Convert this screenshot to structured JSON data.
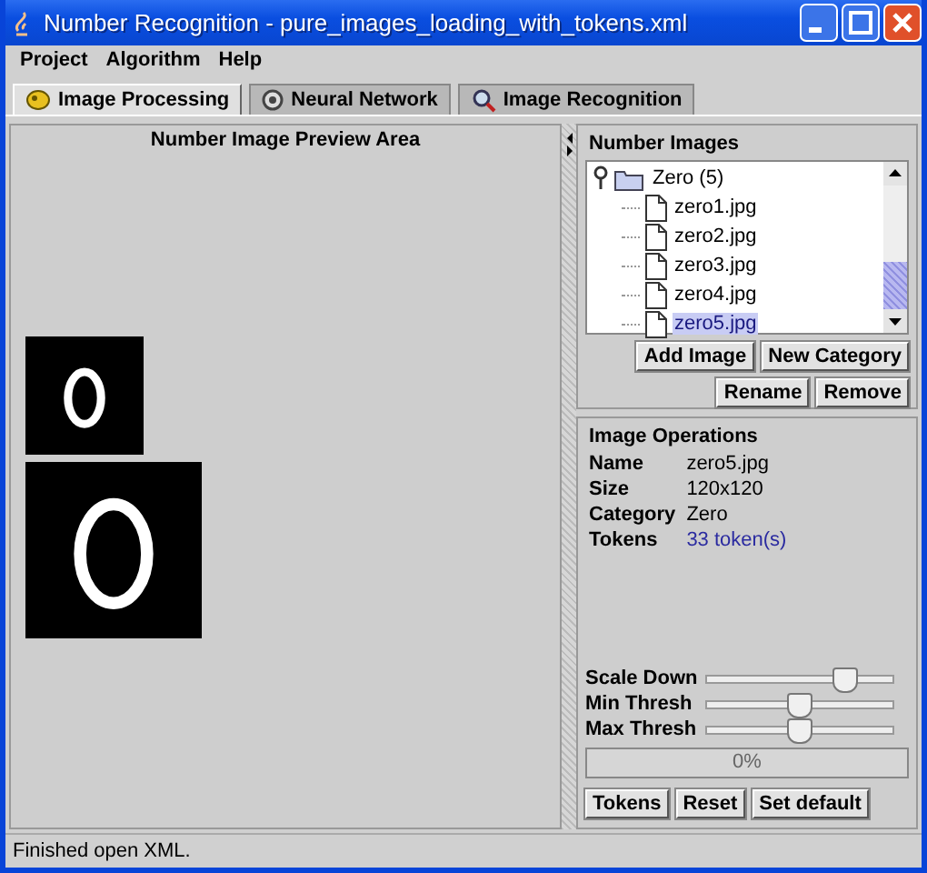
{
  "window": {
    "title": "Number Recognition - pure_images_loading_with_tokens.xml"
  },
  "menu": [
    "Project",
    "Algorithm",
    "Help"
  ],
  "tabs": [
    {
      "label": "Image Processing",
      "selected": true
    },
    {
      "label": "Neural Network",
      "selected": false
    },
    {
      "label": "Image Recognition",
      "selected": false
    }
  ],
  "preview": {
    "title": "Number Image Preview Area"
  },
  "number_images": {
    "title": "Number Images",
    "tree": [
      {
        "label": "Zero (5)",
        "selected": false,
        "expanded": true,
        "children": [
          {
            "label": "zero1.jpg",
            "selected": false
          },
          {
            "label": "zero2.jpg",
            "selected": false
          },
          {
            "label": "zero3.jpg",
            "selected": false
          },
          {
            "label": "zero4.jpg",
            "selected": false
          },
          {
            "label": "zero5.jpg",
            "selected": true
          }
        ]
      }
    ],
    "buttons": [
      [
        "Add Image",
        "New Category"
      ],
      [
        "Rename",
        "Remove"
      ]
    ]
  },
  "image_operations": {
    "title": "Image Operations",
    "fields": [
      {
        "label": "Name",
        "value": "zero5.jpg",
        "kind": "text"
      },
      {
        "label": "Size",
        "value": "120x120",
        "kind": "text"
      },
      {
        "label": "Category",
        "value": "Zero",
        "kind": "text"
      },
      {
        "label": "Tokens",
        "value": "33 token(s)",
        "kind": "link"
      }
    ],
    "sliders": [
      {
        "label": "Scale Down",
        "level": 0.75
      },
      {
        "label": "Min Thresh",
        "level": 0.5
      },
      {
        "label": "Max Thresh",
        "level": 0.5
      }
    ],
    "progress": {
      "level": 0,
      "text": "0%"
    },
    "buttons": [
      "Tokens",
      "Reset",
      "Set default"
    ]
  },
  "status_bar": "Finished open XML."
}
